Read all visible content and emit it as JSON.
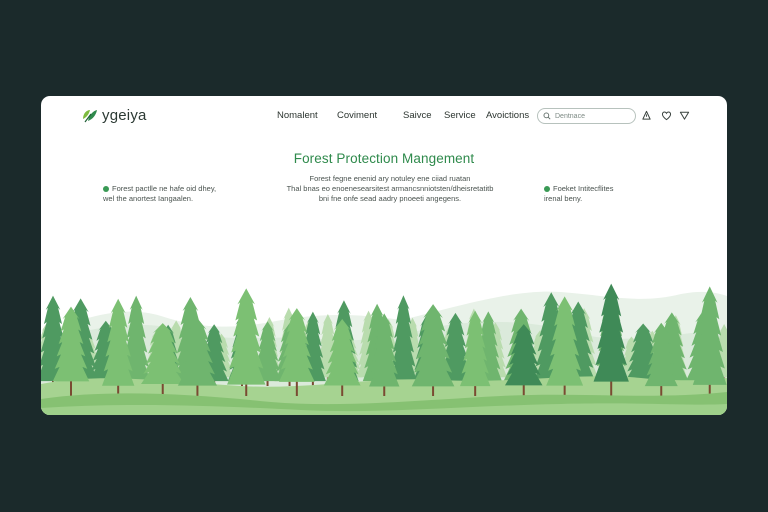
{
  "brand": {
    "name": "ygeiya",
    "logo_icon": "leaf-logo-icon",
    "accent": "#2f8a4c"
  },
  "nav": {
    "items": [
      "Nomalent",
      "Coviment",
      "Saivce",
      "Service",
      "Avoictions"
    ]
  },
  "search": {
    "placeholder": "Dentnace",
    "icon": "search-icon"
  },
  "header_icons": [
    "bell-icon",
    "heart-icon",
    "chevron-down-icon"
  ],
  "hero": {
    "title": "Forest Protection Mangement"
  },
  "info": {
    "left": {
      "line1": "Forest pactlle ne hafe oid dhey,",
      "line2": "wel the anortest Iangaalen."
    },
    "middle": {
      "line1": "Forest fegne enenid ary notuley ene ciiad ruatan",
      "line2": "Thal bnas eo enoenesearsitest armancsnniotsten/dheisretatitb",
      "line3": "bni fne onfe sead aadry pnoeeti angegens."
    },
    "right": {
      "line1": "Foeket Intitecflites",
      "line2": "irenal beny."
    }
  },
  "scene": {
    "colors": {
      "mountain_far": "#e8f1e8",
      "mountain_mid": "#d9e9d8",
      "tree_light": "#a8d29c",
      "tree_mid": "#6fb56e",
      "tree_dark": "#3f8a57",
      "hill": "#8ec77e",
      "trunk": "#7a4a32"
    }
  }
}
